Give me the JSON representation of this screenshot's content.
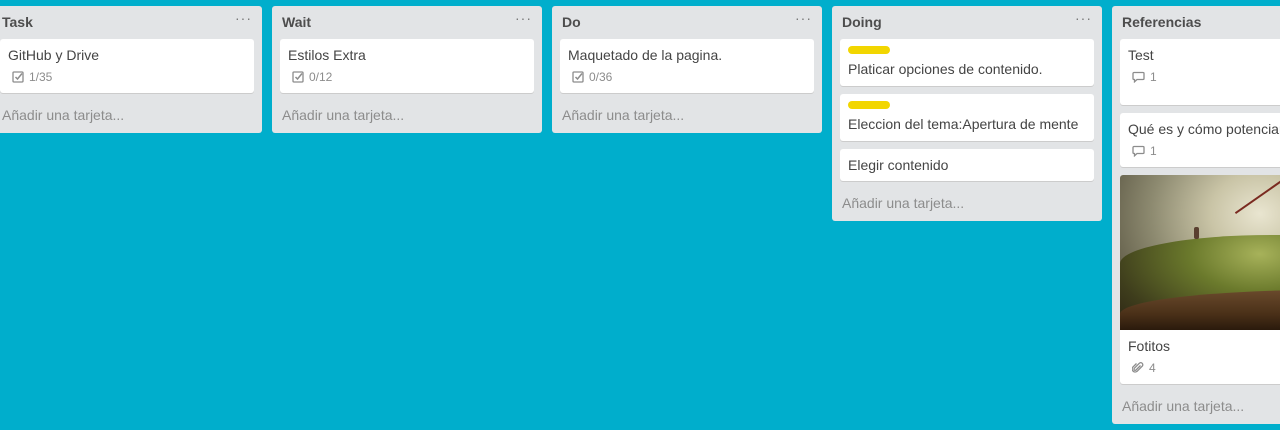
{
  "lists": [
    {
      "title": "Task",
      "menu": "···",
      "add_card": "Añadir una tarjeta...",
      "cards": [
        {
          "title": "GitHub y Drive",
          "badge": {
            "icon": "checklist-icon",
            "text": "1/35"
          }
        }
      ]
    },
    {
      "title": "Wait",
      "menu": "···",
      "add_card": "Añadir una tarjeta...",
      "cards": [
        {
          "title": "Estilos Extra",
          "badge": {
            "icon": "checklist-icon",
            "text": "0/12"
          }
        }
      ]
    },
    {
      "title": "Do",
      "menu": "···",
      "add_card": "Añadir una tarjeta...",
      "cards": [
        {
          "title": "Maquetado de la pagina.",
          "badge": {
            "icon": "checklist-icon",
            "text": "0/36"
          }
        }
      ]
    },
    {
      "title": "Doing",
      "menu": "···",
      "add_card": "Añadir una tarjeta...",
      "label_color": "#f2d600",
      "cards": [
        {
          "title": "Platicar opciones de contenido."
        },
        {
          "title": "Eleccion del tema:Apertura de mente"
        },
        {
          "title": "Elegir contenido"
        }
      ]
    },
    {
      "title": "Referencias",
      "add_card": "Añadir una tarjeta...",
      "cards": [
        {
          "title": "Test",
          "badge": {
            "icon": "comment-icon",
            "text": "1"
          }
        },
        {
          "title": "Qué es y cómo potenciar",
          "badge": {
            "icon": "comment-icon",
            "text": "1"
          }
        },
        {
          "title": "Fotitos",
          "badge": {
            "icon": "attachment-icon",
            "text": "4"
          }
        }
      ]
    }
  ],
  "colors": {
    "board_background": "#00aecc",
    "list_background": "#e2e4e6",
    "label_yellow": "#f2d600"
  }
}
